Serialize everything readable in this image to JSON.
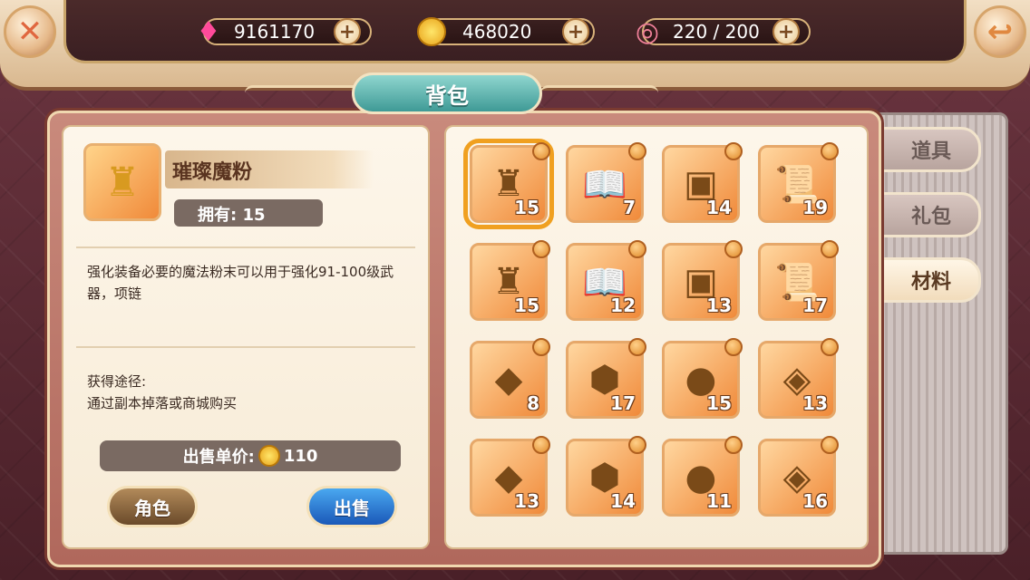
{
  "topbar": {
    "gems": {
      "value": "9161170",
      "icon": "gem-icon"
    },
    "coins": {
      "value": "468020",
      "icon": "coin-icon"
    },
    "stamina": {
      "value": "220 / 200",
      "icon": "donut-icon"
    }
  },
  "title": "背包",
  "detail": {
    "name": "璀璨魔粉",
    "own": "拥有: 15",
    "description": "强化装备必要的魔法粉末可以用于强化91-100级武器，项链",
    "source_label": "获得途径:",
    "source_text": "通过副本掉落或商城购买",
    "price_label": "出售单价:",
    "price_value": "110",
    "btn_role": "角色",
    "btn_sell": "出售"
  },
  "tabs": [
    "道具",
    "礼包",
    "材料"
  ],
  "active_tab": "材料",
  "items": [
    {
      "icon": "golden-lantern-icon",
      "glyph": "♜",
      "count": "15",
      "selected": true
    },
    {
      "icon": "book-icon",
      "glyph": "📖",
      "count": "7"
    },
    {
      "icon": "gold-tablet-icon",
      "glyph": "▣",
      "count": "14"
    },
    {
      "icon": "scroll-icon",
      "glyph": "📜",
      "count": "19"
    },
    {
      "icon": "silver-lantern-icon",
      "glyph": "♜",
      "count": "15"
    },
    {
      "icon": "gem-book-icon",
      "glyph": "📖",
      "count": "12"
    },
    {
      "icon": "orange-tablet-icon",
      "glyph": "▣",
      "count": "13"
    },
    {
      "icon": "red-scroll-icon",
      "glyph": "📜",
      "count": "17"
    },
    {
      "icon": "crystal-icon",
      "glyph": "◆",
      "count": "8"
    },
    {
      "icon": "gold-badge-icon",
      "glyph": "⬢",
      "count": "17"
    },
    {
      "icon": "gold-egg-icon",
      "glyph": "●",
      "count": "15"
    },
    {
      "icon": "gem-plate-icon",
      "glyph": "◈",
      "count": "13"
    },
    {
      "icon": "red-crystal-icon",
      "glyph": "◆",
      "count": "13"
    },
    {
      "icon": "bronze-badge-icon",
      "glyph": "⬢",
      "count": "14"
    },
    {
      "icon": "red-egg-icon",
      "glyph": "●",
      "count": "11"
    },
    {
      "icon": "blue-gem-plate-icon",
      "glyph": "◈",
      "count": "16"
    }
  ]
}
